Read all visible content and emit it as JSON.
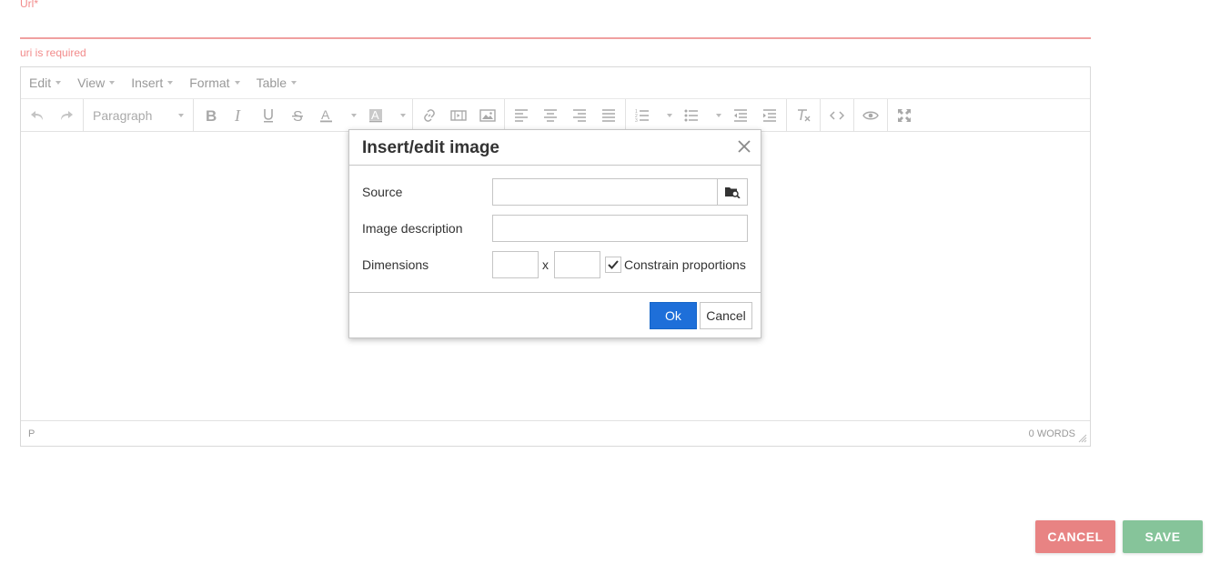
{
  "form": {
    "url_label": "Url*",
    "url_value": "",
    "url_error": "uri is required",
    "cancel_label": "CANCEL",
    "save_label": "SAVE"
  },
  "editor": {
    "menu": [
      "Edit",
      "View",
      "Insert",
      "Format",
      "Table"
    ],
    "block_format": "Paragraph",
    "status_path": "P",
    "word_count": "0 WORDS"
  },
  "dialog": {
    "title": "Insert/edit image",
    "source_label": "Source",
    "source_value": "",
    "description_label": "Image description",
    "description_value": "",
    "dimensions_label": "Dimensions",
    "width_value": "",
    "height_value": "",
    "dimension_separator": "x",
    "constrain_label": "Constrain proportions",
    "constrain_checked": true,
    "ok_label": "Ok",
    "cancel_label": "Cancel"
  },
  "colors": {
    "error": "#f28b8b",
    "primary": "#1e6fd9",
    "cancel_button": "#e88383",
    "save_button": "#86c49a"
  }
}
